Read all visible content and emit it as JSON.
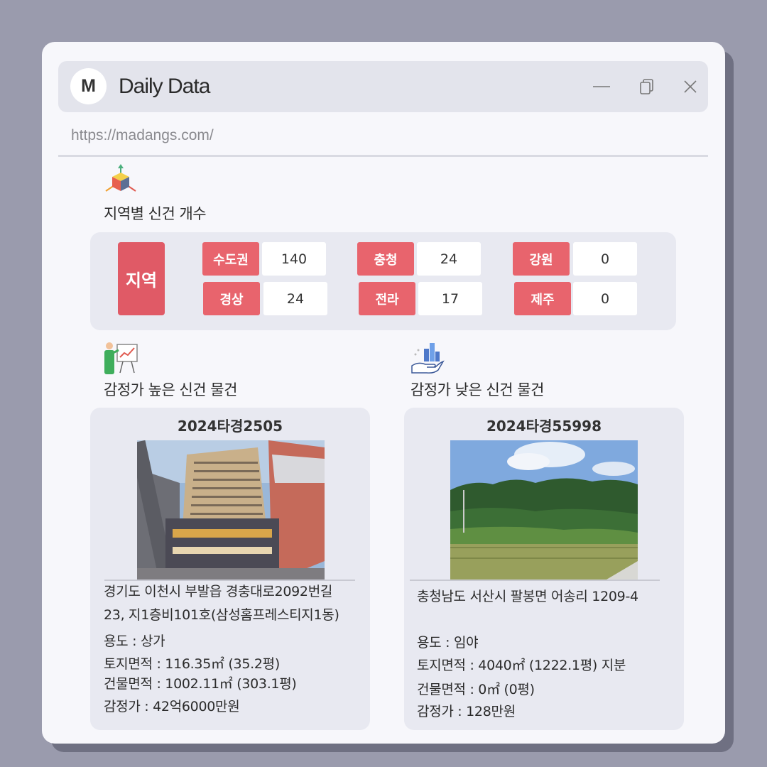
{
  "window": {
    "logo_letter": "M",
    "title": "Daily Data",
    "url": "https://madangs.com/"
  },
  "region_section": {
    "title": "지역별 신건 개수",
    "icon": "axes-cube-icon",
    "main_label": "지역",
    "regions": [
      {
        "label": "수도권",
        "count": "140"
      },
      {
        "label": "충청",
        "count": "24"
      },
      {
        "label": "강원",
        "count": "0"
      },
      {
        "label": "경상",
        "count": "24"
      },
      {
        "label": "전라",
        "count": "17"
      },
      {
        "label": "제주",
        "count": "0"
      }
    ]
  },
  "high_section": {
    "title": "감정가 높은 신건 물건",
    "icon": "presentation-chart-icon",
    "case_no": "2024타경2505",
    "address_line1": "경기도 이천시 부발읍 경충대로2092번길",
    "address_line2": "23, 지1층비101호(삼성홈프레스티지1동)",
    "usage": "용도 : 상가",
    "land_area": "토지면적 : 116.35㎡ (35.2평)",
    "building_area": "건물면적 : 1002.11㎡ (303.1평)",
    "appraisal": "감정가 : 42억6000만원"
  },
  "low_section": {
    "title": "감정가 낮은 신건 물건",
    "icon": "hand-chart-icon",
    "case_no": "2024타경55998",
    "address_line1": "충청남도 서산시 팔봉면 어송리 1209-4",
    "usage": "용도 : 임야",
    "land_area": "토지면적 : 4040㎡ (1222.1평) 지분",
    "building_area": "건물면적 : 0㎡ (0평)",
    "appraisal": "감정가 : 128만원"
  },
  "colors": {
    "background": "#9a9bad",
    "window": "#f7f7fb",
    "accent_red": "#e8646d",
    "panel": "#e8e9f1"
  }
}
